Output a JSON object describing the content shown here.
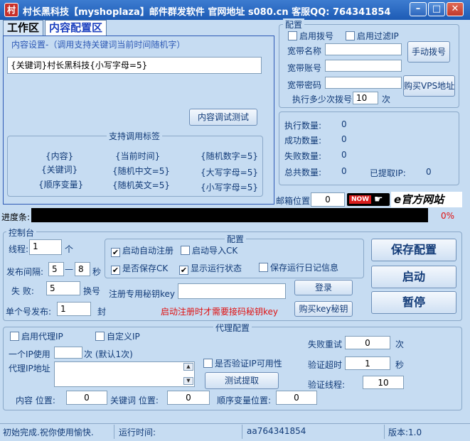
{
  "window": {
    "app_icon_char": "村",
    "title": "村长黑科技【myshoplaza】邮件群发软件   官网地址 s080.cn   客服QQ: 764341854",
    "minimize": "–",
    "maximize": "□",
    "close": "✕"
  },
  "tabs": [
    {
      "label": "工作区"
    },
    {
      "label": "内容配置区"
    }
  ],
  "content_settings": {
    "hint": "内容设置-（调用支持关键词当前时间随机字）",
    "value": "{关键词}村长黑科技{小写字母=5}",
    "test_button": "内容调试测试"
  },
  "tags": {
    "title": "支持调用标签",
    "items": [
      "{内容}",
      "{当前时间}",
      "{随机数字=5}",
      "{关键词}",
      "{随机中文=5}",
      "{大写字母=5}",
      "{顺序变量}",
      "{随机英文=5}",
      "{小写字母=5}"
    ]
  },
  "config": {
    "title": "配置",
    "enable_dial": "启用拨号",
    "enable_filter": "启用过滤IP",
    "broadband_name": "宽带名称",
    "broadband_account": "宽带账号",
    "broadband_password": "宽带密码",
    "manual_dial": "手动拨号",
    "buy_vps": "购买VPS地址",
    "dial_after": "执行多少次拨号",
    "dial_after_value": "10",
    "dial_after_unit": "次"
  },
  "stats": {
    "executed_label": "执行数量:",
    "executed": "0",
    "success_label": "成功数量:",
    "success": "0",
    "failed_label": "失败数量:",
    "failed": "0",
    "total_label": "总共数量:",
    "total": "0",
    "extracted_label": "已提取IP:",
    "extracted": "0"
  },
  "mailbox": {
    "label": "邮箱位置",
    "value": "0",
    "now_badge": "NOW",
    "official_logo": "e官方网站"
  },
  "progress": {
    "label": "进度条:",
    "percent_text": "0%",
    "fraction": 0
  },
  "console": {
    "title": "控制台",
    "threads_label": "线程:",
    "threads": "1",
    "threads_unit": "个",
    "interval_label": "发布间隔:",
    "interval_min": "5",
    "interval_dash": "—",
    "interval_max": "8",
    "interval_unit": "秒",
    "fail_label": "失 败:",
    "fail": "5",
    "fail_unit": "换号",
    "single_label": "单个号发布:",
    "single": "1",
    "single_unit": "封"
  },
  "options": {
    "title": "配置",
    "auto_register": "启动自动注册",
    "auto_register_checked": true,
    "auto_import_ck": "启动导入CK",
    "auto_import_ck_checked": false,
    "save_ck": "是否保存CK",
    "save_ck_checked": true,
    "show_status": "显示运行状态",
    "show_status_checked": true,
    "save_log": "保存运行日记信息",
    "save_log_checked": false,
    "key_label": "注册专用秘钥key",
    "key_value": "",
    "login_button": "登录",
    "buy_key_button": "购买key秘钥",
    "notice": "启动注册时才需要接码秘钥key"
  },
  "actions": {
    "save": "保存配置",
    "start": "启动",
    "pause": "暂停"
  },
  "proxy": {
    "title": "代理配置",
    "enable_proxy": "启用代理IP",
    "custom_ip": "自定义IP",
    "per_ip_label": "一个IP使用",
    "per_ip_value": "",
    "per_ip_unit": "次 (默认1次)",
    "address_label": "代理IP地址",
    "verify_ip": "是否验证IP可用性",
    "test_extract": "测试提取",
    "fail_retry_label": "失败重试",
    "fail_retry": "0",
    "fail_retry_unit": "次",
    "timeout_label": "验证超时",
    "timeout": "1",
    "timeout_unit": "秒",
    "verify_threads_label": "验证线程:",
    "verify_threads": "10"
  },
  "positions": {
    "content_label": "内容 位置:",
    "content": "0",
    "keyword_label": "关键词 位置:",
    "keyword": "0",
    "sequence_label": "顺序变量位置:",
    "sequence": "0"
  },
  "status": {
    "message": "初始完成.祝你使用愉快.",
    "runtime_label": "运行时间:",
    "user": "aa764341854",
    "version": "版本:1.0"
  }
}
